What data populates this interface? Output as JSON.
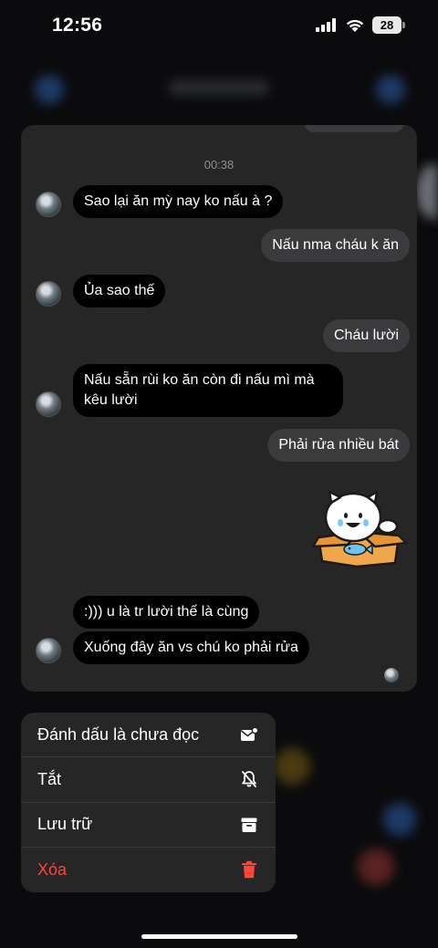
{
  "status_bar": {
    "time": "12:56",
    "battery": "28"
  },
  "chat": {
    "timestamp": "00:38",
    "messages": [
      {
        "direction": "incoming",
        "text": "Sao lại ăn mỳ nay ko nấu à ?"
      },
      {
        "direction": "outgoing",
        "text": "Nấu nma cháu k ăn"
      },
      {
        "direction": "incoming",
        "text": "Ủa sao thế"
      },
      {
        "direction": "outgoing",
        "text": "Cháu lười"
      },
      {
        "direction": "incoming",
        "text": "Nấu sẵn rùi ko ăn còn đi nấu mì mà kêu lười"
      },
      {
        "direction": "outgoing",
        "text": "Phải rửa nhiều bát"
      },
      {
        "direction": "outgoing",
        "sticker": "cat-in-box-sticker"
      },
      {
        "direction": "incoming",
        "text": ":))) u là tr lười thế là cùng"
      },
      {
        "direction": "incoming",
        "text": "Xuống đây ăn vs chú ko phải rửa"
      }
    ]
  },
  "menu": {
    "items": [
      {
        "label": "Đánh dấu là chưa đọc",
        "icon": "mark-unread-icon"
      },
      {
        "label": "Tắt",
        "icon": "bell-slash-icon"
      },
      {
        "label": "Lưu trữ",
        "icon": "archive-icon"
      },
      {
        "label": "Xóa",
        "icon": "trash-icon",
        "color": "#ff453a"
      }
    ]
  },
  "colors": {
    "background": "#0b0b0d",
    "card": "#262626",
    "incoming_bubble": "#000000",
    "outgoing_bubble": "#3b3b3d",
    "danger": "#ff453a"
  }
}
